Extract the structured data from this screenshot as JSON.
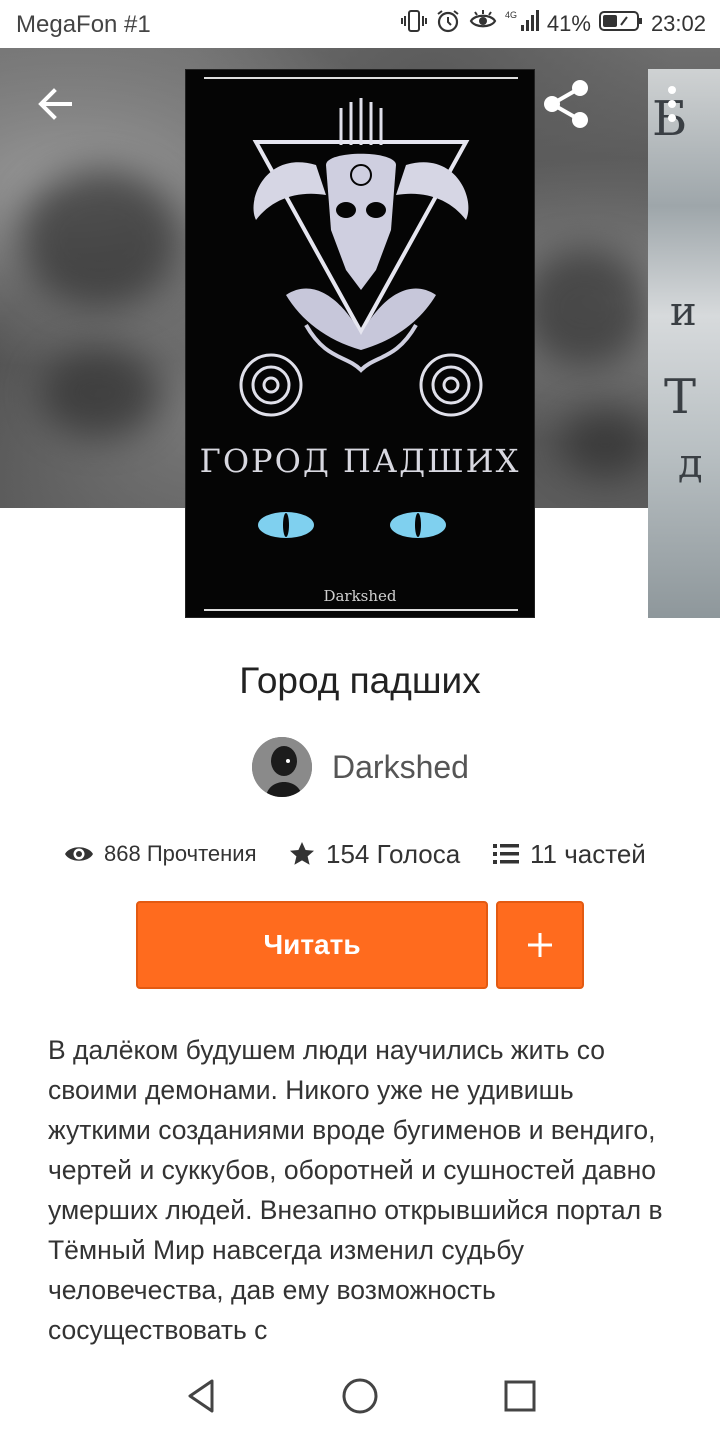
{
  "status_bar": {
    "carrier": "MegaFon #1",
    "battery": "41%",
    "time": "23:02",
    "icons": [
      "vibrate-icon",
      "alarm-icon",
      "eye-icon",
      "signal-4g-icon",
      "battery-icon"
    ]
  },
  "toolbar": {
    "back_icon": "arrow-left-icon",
    "share_icon": "share-icon",
    "more_icon": "more-vertical-icon"
  },
  "cover": {
    "title": "ГОРОД ПАДШИХ",
    "author": "Darkshed"
  },
  "book": {
    "title": "Город падших",
    "author": "Darkshed"
  },
  "stats": {
    "views": "868 Прочтения",
    "votes": "154 Голоса",
    "parts": "11 частей"
  },
  "actions": {
    "read_label": "Читать",
    "add_label": "+"
  },
  "description": "В далёком будушем люди научились жить со своими демонами. Никого уже не удивишь жуткими созданиями вроде бугименов и вендиго, чертей и суккубов, оборотней и сушностей давно умерших людей. Внезапно открывшийся портал в Тёмный Мир навсегда изменил судьбу человечества, дав ему возможность сосуществовать с",
  "colors": {
    "accent": "#ff6b1e",
    "text": "#333333"
  }
}
